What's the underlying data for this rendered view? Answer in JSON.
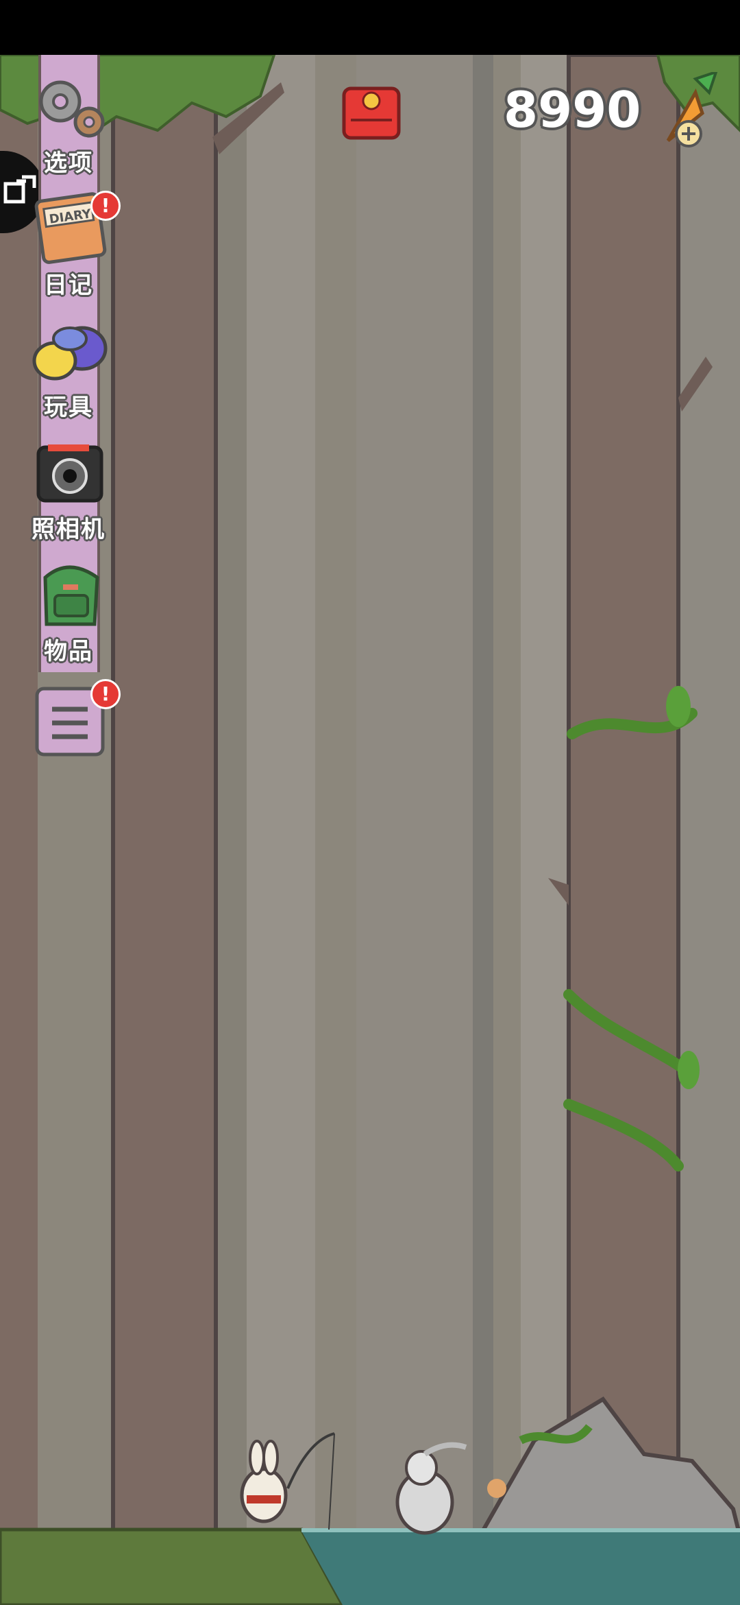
{
  "menu": {
    "options_label": "选项",
    "diary_label": "日记",
    "toys_label": "玩具",
    "camera_label": "照相机",
    "items_label": "物品",
    "diary_badge": "!",
    "list_badge": "!"
  },
  "hud": {
    "carrot_count": "8990",
    "diary_icon_text": "DIARY"
  },
  "colors": {
    "forest_bg": "#8c877c",
    "tree_trunk": "#7c6a63",
    "menu_rail": "#cfa9cf",
    "water": "#3f7a78",
    "grass": "#5e7a3c",
    "badge_red": "#e53935"
  }
}
